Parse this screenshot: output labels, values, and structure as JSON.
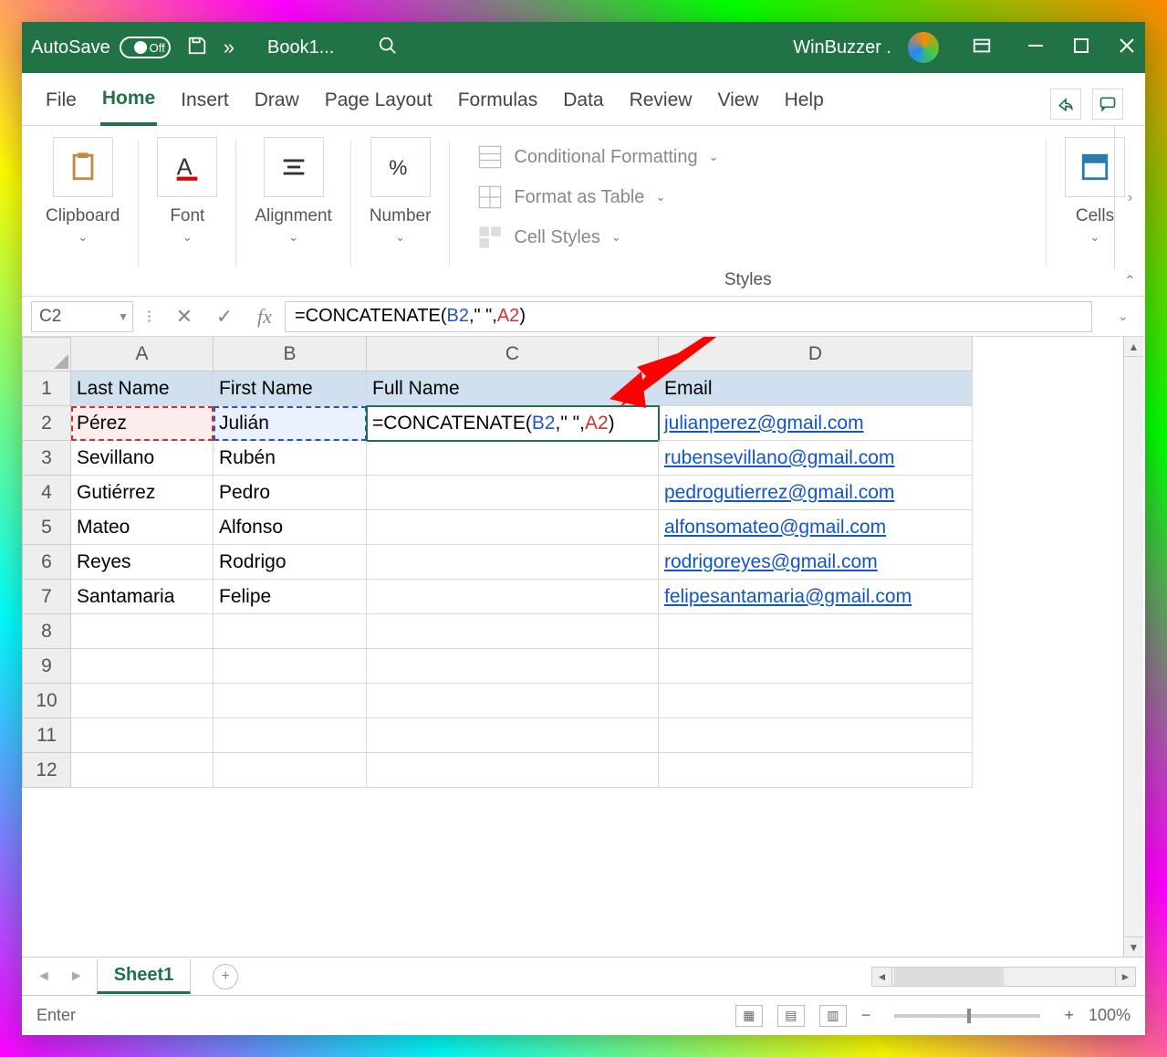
{
  "titlebar": {
    "autosave_label": "AutoSave",
    "autosave_state": "Off",
    "filename": "Book1...",
    "user": "WinBuzzer ."
  },
  "ribbon": {
    "tabs": [
      "File",
      "Home",
      "Insert",
      "Draw",
      "Page Layout",
      "Formulas",
      "Data",
      "Review",
      "View",
      "Help"
    ],
    "active_tab": "Home",
    "groups": {
      "clipboard": "Clipboard",
      "font": "Font",
      "alignment": "Alignment",
      "number": "Number",
      "styles": "Styles",
      "cells": "Cells"
    },
    "styles_items": {
      "conditional": "Conditional Formatting",
      "format_table": "Format as Table",
      "cell_styles": "Cell Styles"
    }
  },
  "formula_bar": {
    "name_box": "C2",
    "formula_prefix": "=CONCATENATE(",
    "formula_ref1": "B2",
    "formula_mid": ",\" \",",
    "formula_ref2": "A2",
    "formula_suffix": ")"
  },
  "grid": {
    "columns": [
      "A",
      "B",
      "C",
      "D"
    ],
    "row_count": 12,
    "headers": {
      "A": "Last Name",
      "B": "First Name",
      "C": "Full Name",
      "D": "Email"
    },
    "rows": [
      {
        "A": "Pérez",
        "B": "Julián",
        "C_formula": {
          "prefix": "=CONCATENATE(",
          "ref1": "B2",
          "mid": ",\" \",",
          "ref2": "A2",
          "suffix": ")"
        },
        "D": "julianperez@gmail.com"
      },
      {
        "A": "Sevillano",
        "B": "Rubén",
        "C": "",
        "D": "rubensevillano@gmail.com"
      },
      {
        "A": "Gutiérrez",
        "B": "Pedro",
        "C": "",
        "D": "pedrogutierrez@gmail.com"
      },
      {
        "A": "Mateo",
        "B": "Alfonso",
        "C": "",
        "D": "alfonsomateo@gmail.com"
      },
      {
        "A": "Reyes",
        "B": "Rodrigo",
        "C": "",
        "D": "rodrigoreyes@gmail.com"
      },
      {
        "A": "Santamaria",
        "B": "Felipe",
        "C": "",
        "D": "felipesantamaria@gmail.com"
      }
    ]
  },
  "sheet_tabs": {
    "active": "Sheet1"
  },
  "status_bar": {
    "mode": "Enter",
    "zoom": "100%"
  }
}
